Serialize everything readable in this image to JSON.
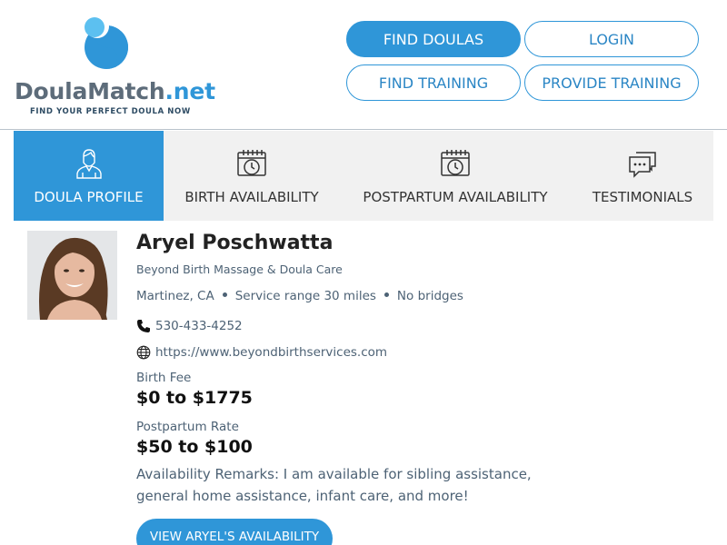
{
  "brand": {
    "name_main": "DoulaMatch",
    "name_suffix": ".net",
    "tagline": "FIND YOUR PERFECT DOULA NOW",
    "primary_color": "#2f96d8",
    "text_color": "#5d6c7a"
  },
  "nav": {
    "find_doulas": "FIND DOULAS",
    "login": "LOGIN",
    "find_training": "FIND TRAINING",
    "provide_training": "PROVIDE TRAINING"
  },
  "tabs": [
    {
      "label": "DOULA PROFILE",
      "icon": "doula-person-icon",
      "active": true
    },
    {
      "label": "BIRTH AVAILABILITY",
      "icon": "calendar-clock-icon",
      "active": false
    },
    {
      "label": "POSTPARTUM AVAILABILITY",
      "icon": "calendar-clock-icon",
      "active": false
    },
    {
      "label": "TESTIMONIALS",
      "icon": "chat-bubbles-icon",
      "active": false
    }
  ],
  "profile": {
    "name": "Aryel Poschwatta",
    "business": "Beyond Birth Massage & Doula Care",
    "location": "Martinez, CA",
    "service_range": "Service range 30 miles",
    "bridges": "No bridges",
    "phone": "530-433-4252",
    "website": "https://www.beyondbirthservices.com",
    "birth_fee_label": "Birth Fee",
    "birth_fee_value": "$0 to $1775",
    "pp_rate_label": "Postpartum Rate",
    "pp_rate_value": "$50 to $100",
    "remarks": "Availability Remarks: I am available for sibling assistance, general home assistance, infant care, and more!",
    "availability_button": "VIEW ARYEL'S AVAILABILITY"
  }
}
